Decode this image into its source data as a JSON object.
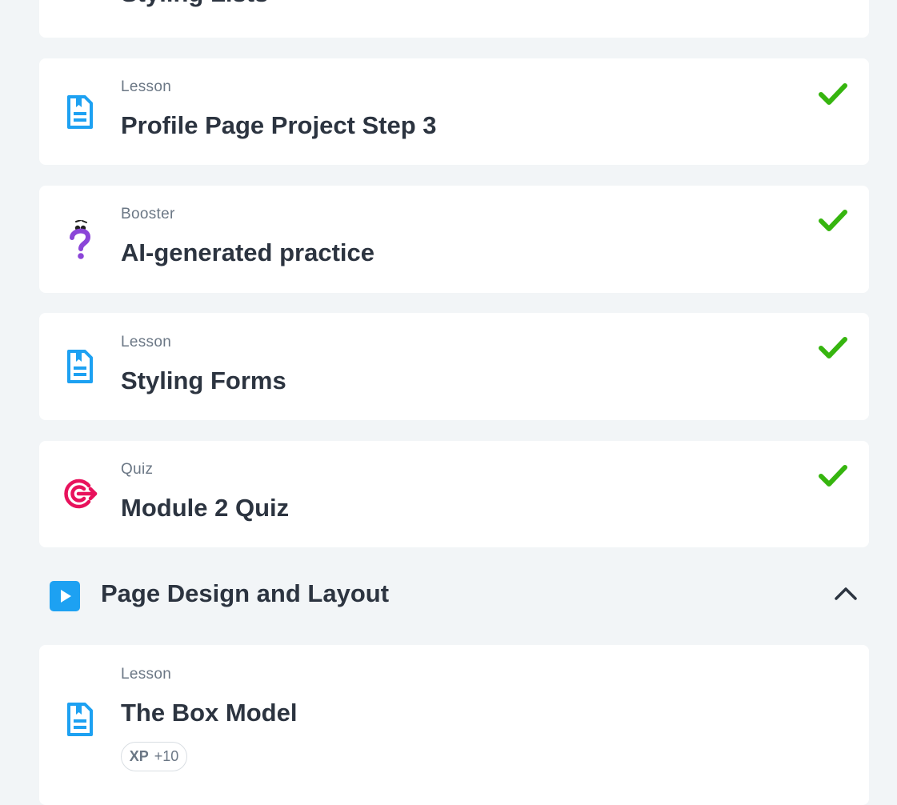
{
  "colors": {
    "background": "#f2f5f7",
    "card": "#ffffff",
    "lesson_icon": "#1da1f2",
    "booster_icon": "#8b45d8",
    "quiz_icon": "#e8125c",
    "check": "#36b50f",
    "title_text": "#2c3440",
    "type_text": "#6b7785"
  },
  "items": [
    {
      "type": "",
      "title": "Styling Lists",
      "icon": "lesson-doc-icon"
    },
    {
      "type": "Lesson",
      "title": "Profile Page Project Step 3",
      "icon": "lesson-doc-icon",
      "completed": true
    },
    {
      "type": "Booster",
      "title": "AI-generated practice",
      "icon": "question-mark-icon",
      "completed": true
    },
    {
      "type": "Lesson",
      "title": "Styling Forms",
      "icon": "lesson-doc-icon",
      "completed": true
    },
    {
      "type": "Quiz",
      "title": "Module 2 Quiz",
      "icon": "target-icon",
      "completed": true
    }
  ],
  "section": {
    "title": "Page Design and Layout",
    "icon": "play-icon",
    "toggle_icon": "chevron-up-icon",
    "expanded": true
  },
  "section_items": [
    {
      "type": "Lesson",
      "title": "The Box Model",
      "icon": "lesson-doc-icon",
      "xp_label": "XP",
      "xp_value": "+10"
    }
  ]
}
